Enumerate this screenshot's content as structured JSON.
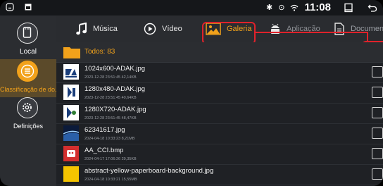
{
  "statusbar": {
    "time": "11:08"
  },
  "sidebar": {
    "items": [
      {
        "label": "Local",
        "icon": "sd-card-icon"
      },
      {
        "label": "Classificação de do...",
        "icon": "list-icon"
      },
      {
        "label": "Definições",
        "icon": "gear-icon"
      }
    ]
  },
  "tabs": {
    "items": [
      {
        "label": "Música",
        "icon": "music-note-icon"
      },
      {
        "label": "Vídeo",
        "icon": "play-icon"
      },
      {
        "label": "Galeria",
        "icon": "image-icon"
      },
      {
        "label": "Aplicação",
        "icon": "android-icon"
      },
      {
        "label": "Documento",
        "icon": "document-icon"
      }
    ],
    "active_index": 2
  },
  "list": {
    "all_label": "Todos: 83",
    "files": [
      {
        "name": "1024x600-ADAK.jpg",
        "meta": "2023-12-28 23:51:45  42,14KB"
      },
      {
        "name": "1280x480-ADAK.jpg",
        "meta": "2023-12-28 23:51:45  40,64KB"
      },
      {
        "name": "1280X720-ADAK.jpg",
        "meta": "2023-12-28 23:51:45  48,47KB"
      },
      {
        "name": "62341617.jpg",
        "meta": "2024-04-18 10:33:23  8,21MB"
      },
      {
        "name": "AA_CCI.bmp",
        "meta": "2024-04-17 17:06:26  29,35KB"
      },
      {
        "name": "abstract-yellow-paperboard-background.jpg",
        "meta": "2024-04-18 10:33:21  15,55MB"
      }
    ]
  },
  "colors": {
    "accent": "#f2a21b",
    "highlight": "#e0222b"
  }
}
